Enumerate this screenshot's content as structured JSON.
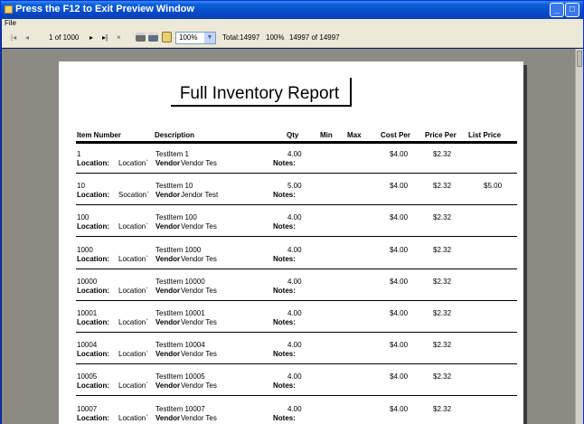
{
  "window": {
    "title": "Press the F12 to Exit Preview Window"
  },
  "menu": {
    "file": "File"
  },
  "toolbar": {
    "nav_first": "|◂",
    "nav_prev": "◂",
    "page_field": "1 of 1000",
    "nav_next": "▸",
    "nav_last": "▸|",
    "close_label": "×",
    "zoom_value": "100%",
    "total_label": "Total:14997",
    "zoom_status": "100%",
    "count_status": "14997 of 14997"
  },
  "report": {
    "title": "Full Inventory Report",
    "columns": {
      "item_number": "Item Number",
      "description": "Description",
      "qty": "Qty",
      "min": "Min",
      "max": "Max",
      "cost_per": "Cost Per",
      "price_per": "Price Per",
      "list_price": "List Price"
    },
    "labels": {
      "location": "Location:",
      "vendor": "Vendor",
      "notes": "Notes:"
    },
    "records": [
      {
        "item": "1",
        "desc": "TestItem 1",
        "qty": "4.00",
        "cost": "$4.00",
        "price": "$2.32",
        "list": "",
        "location": "Location`",
        "vendor": "Vendor Tes"
      },
      {
        "item": "10",
        "desc": "TestItem 10",
        "qty": "5.00",
        "cost": "$4.00",
        "price": "$2.32",
        "list": "$5.00",
        "location": "Socation`",
        "vendor": "Jendor Test"
      },
      {
        "item": "100",
        "desc": "TestItem 100",
        "qty": "4.00",
        "cost": "$4.00",
        "price": "$2.32",
        "list": "",
        "location": "Location`",
        "vendor": "Vendor Tes"
      },
      {
        "item": "1000",
        "desc": "TestItem 1000",
        "qty": "4.00",
        "cost": "$4.00",
        "price": "$2.32",
        "list": "",
        "location": "Location`",
        "vendor": "Vendor Tes"
      },
      {
        "item": "10000",
        "desc": "TestItem 10000",
        "qty": "4.00",
        "cost": "$4.00",
        "price": "$2.32",
        "list": "",
        "location": "Location`",
        "vendor": "Vendor Tes"
      },
      {
        "item": "10001",
        "desc": "TestItem 10001",
        "qty": "4.00",
        "cost": "$4.00",
        "price": "$2.32",
        "list": "",
        "location": "Location`",
        "vendor": "Vendor Tes"
      },
      {
        "item": "10004",
        "desc": "TestItem 10004",
        "qty": "4.00",
        "cost": "$4.00",
        "price": "$2.32",
        "list": "",
        "location": "Location`",
        "vendor": "Vendor Tes"
      },
      {
        "item": "10005",
        "desc": "TestItem 10005",
        "qty": "4.00",
        "cost": "$4.00",
        "price": "$2.32",
        "list": "",
        "location": "Location`",
        "vendor": "Vendor Tes"
      },
      {
        "item": "10007",
        "desc": "TestItem 10007",
        "qty": "4.00",
        "cost": "$4.00",
        "price": "$2.32",
        "list": "",
        "location": "Location`",
        "vendor": "Vendor Tes"
      }
    ]
  }
}
